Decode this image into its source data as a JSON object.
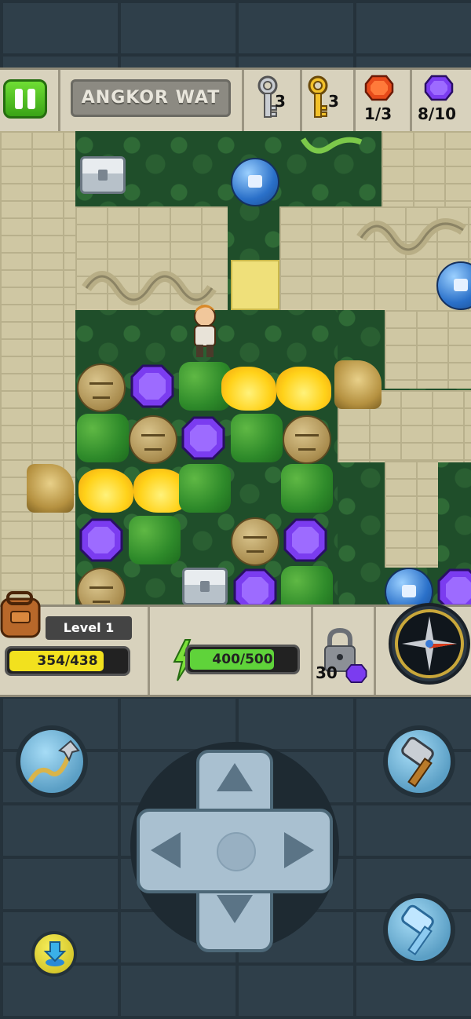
{
  "header": {
    "level_name": "ANGKOR WAT",
    "silver_keys": "3",
    "gold_keys": "3",
    "red_gems": "1/3",
    "purple_gems": "8/10"
  },
  "status": {
    "level_label": "Level 1",
    "xp": "354/438",
    "xp_fraction": 0.808,
    "energy": "400/500",
    "energy_fraction": 0.8,
    "lock_cost": "30"
  },
  "colors": {
    "accent_green": "#4bc72a",
    "xp_yellow": "#f2e11e",
    "energy_green": "#5fd33a",
    "purple_gem": "#7b3cf0",
    "red_gem": "#e64a1a"
  },
  "controls": {
    "left_top_icon": "rope-hook-icon",
    "right_top_icon": "hammer-icon",
    "right_bottom_icon": "ice-hammer-icon",
    "left_bottom_icon": "download-arrow-icon"
  }
}
